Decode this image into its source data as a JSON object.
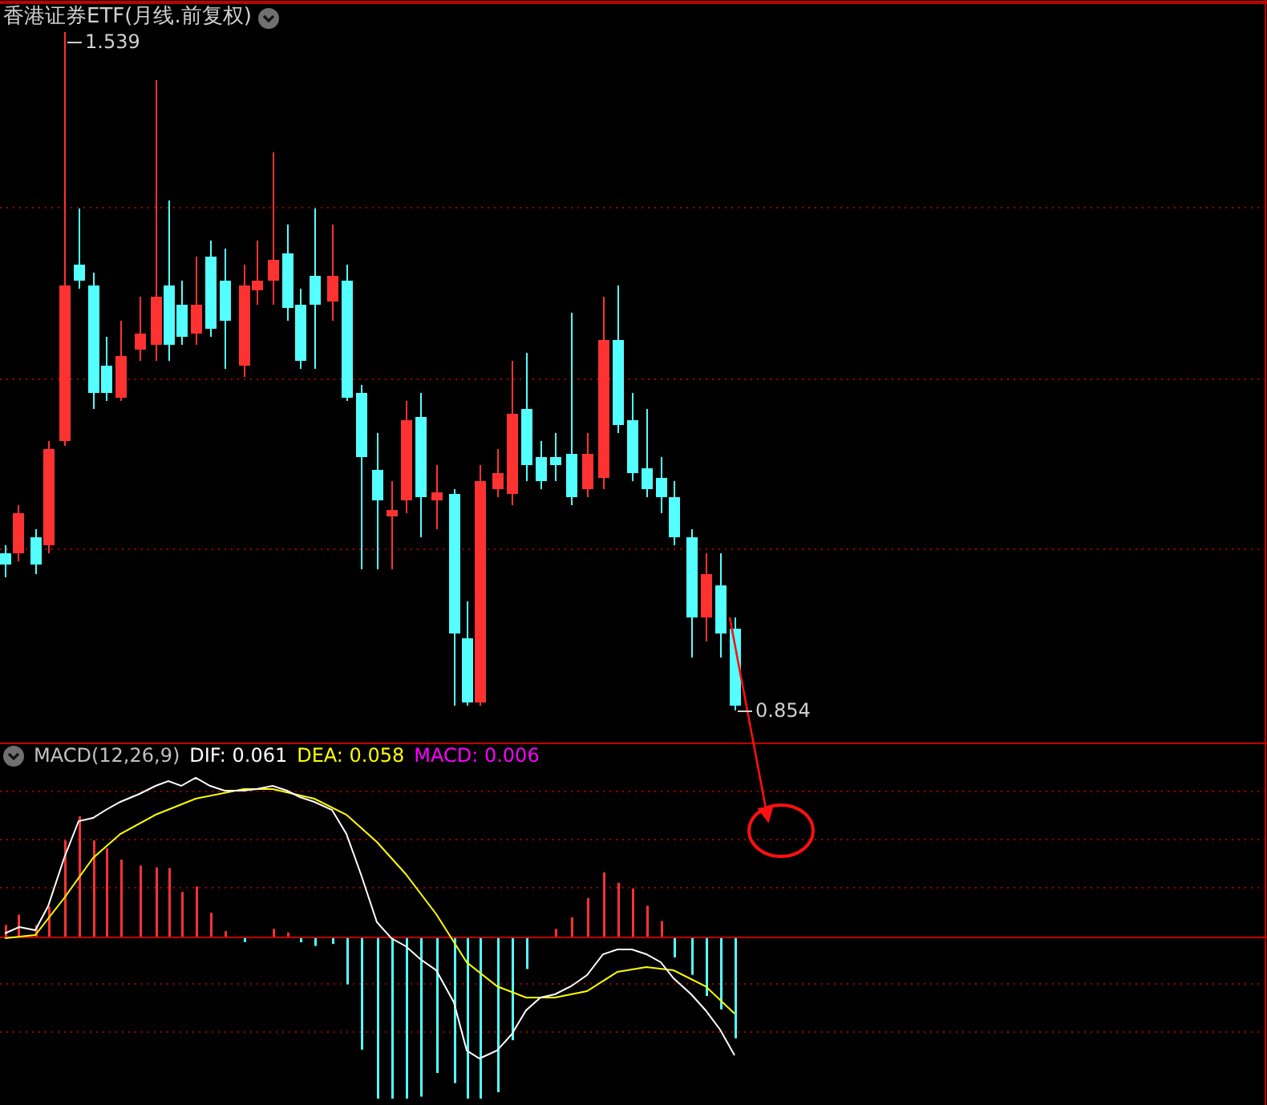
{
  "title": {
    "text": "香港证券ETF(月线.前复权)"
  },
  "price_chart": {
    "high_label": "1.539",
    "low_label": "0.854"
  },
  "macd_panel": {
    "name": "MACD(12,26,9)",
    "indicators": [
      {
        "label": "DIF: 0.061",
        "color": "#ffffff"
      },
      {
        "label": "DEA: 0.058",
        "color": "#ffff00"
      },
      {
        "label": "MACD: 0.006",
        "color": "#ff00ff"
      }
    ]
  }
}
